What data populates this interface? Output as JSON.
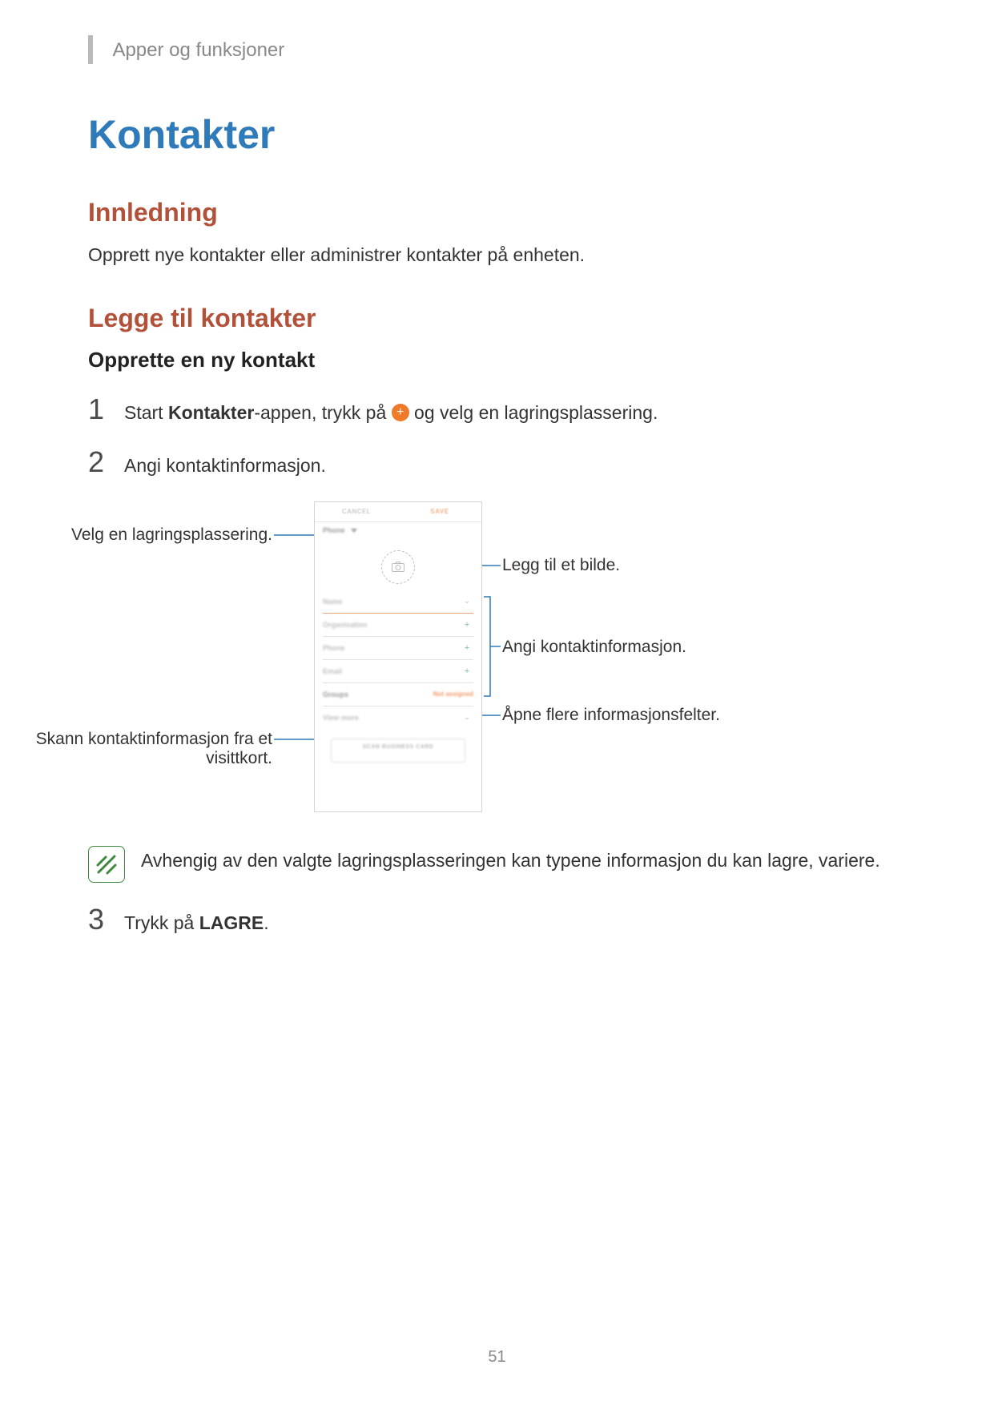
{
  "breadcrumb": "Apper og funksjoner",
  "title": "Kontakter",
  "section_intro": {
    "heading": "Innledning",
    "body": "Opprett nye kontakter eller administrer kontakter på enheten."
  },
  "section_add": {
    "heading": "Legge til kontakter",
    "subheading": "Opprette en ny kontakt"
  },
  "steps": {
    "s1_num": "1",
    "s1_a": "Start ",
    "s1_b": "Kontakter",
    "s1_c": "-appen, trykk på ",
    "s1_d": " og velg en lagringsplassering.",
    "s2_num": "2",
    "s2": "Angi kontaktinformasjon.",
    "s3_num": "3",
    "s3_a": "Trykk på ",
    "s3_b": "LAGRE",
    "s3_c": "."
  },
  "callouts": {
    "left1": "Velg en lagringsplassering.",
    "left2": "Skann kontaktinformasjon fra et visittkort.",
    "right1": "Legg til et bilde.",
    "right2": "Angi kontaktinformasjon.",
    "right3": "Åpne flere informasjonsfelter."
  },
  "phone": {
    "cancel": "CANCEL",
    "save": "SAVE",
    "storage": "Phone",
    "fields": {
      "name": "Name",
      "org": "Organisation",
      "phone": "Phone",
      "email": "Email",
      "groups": "Groups",
      "groups_value": "Not assigned",
      "more": "View more"
    },
    "scan": "SCAN BUSINESS CARD"
  },
  "note": "Avhengig av den valgte lagringsplasseringen kan typene informasjon du kan lagre, variere.",
  "page_number": "51"
}
